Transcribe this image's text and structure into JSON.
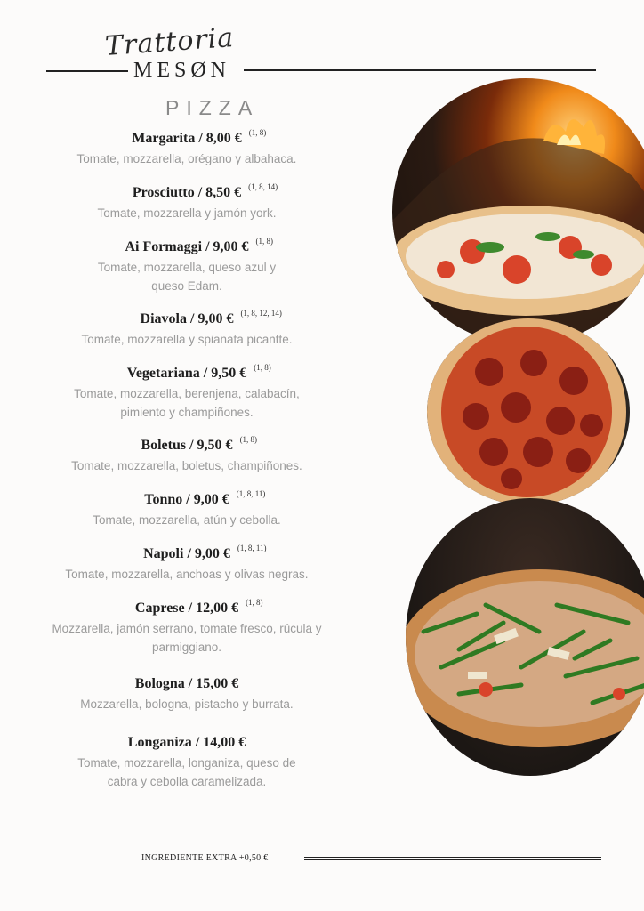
{
  "header": {
    "brand_script": "Trattoria",
    "brand_name": "MESØN",
    "section_title": "PIZZA"
  },
  "menu": {
    "items": [
      {
        "name": "Margarita / 8,00 €",
        "allergens": "(1, 8)",
        "description": "Tomate, mozzarella, orégano y albahaca."
      },
      {
        "name": "Prosciutto / 8,50 €",
        "allergens": "(1, 8, 14)",
        "description": "Tomate, mozzarella y jamón york."
      },
      {
        "name": "Ai Formaggi / 9,00 €",
        "allergens": "(1, 8)",
        "description": "Tomate, mozzarella, queso azul y queso Edam."
      },
      {
        "name": "Diavola / 9,00 €",
        "allergens": "(1, 8, 12, 14)",
        "description": "Tomate, mozzarella y spianata picantte."
      },
      {
        "name": "Vegetariana / 9,50 €",
        "allergens": "(1, 8)",
        "description": "Tomate, mozzarella, berenjena, calabacín, pimiento y champiñones."
      },
      {
        "name": "Boletus / 9,50 €",
        "allergens": "(1, 8)",
        "description": "Tomate, mozzarella, boletus, champiñones."
      },
      {
        "name": "Tonno / 9,00 €",
        "allergens": "(1, 8, 11)",
        "description": "Tomate, mozzarella, atún y cebolla."
      },
      {
        "name": "Napoli / 9,00 €",
        "allergens": "(1, 8, 11)",
        "description": "Tomate, mozzarella, anchoas y olivas negras."
      },
      {
        "name": "Caprese / 12,00 €",
        "allergens": "(1, 8)",
        "description": "Mozzarella, jamón serrano, tomate fresco, rúcula y parmiggiano."
      },
      {
        "name": "Bologna / 15,00 €",
        "allergens": "",
        "description": "Mozzarella, bologna, pistacho y burrata."
      },
      {
        "name": "Longaniza / 14,00 €",
        "allergens": "",
        "description": "Tomate, mozzarella, longaniza, queso de cabra y cebolla caramelizada."
      }
    ]
  },
  "photos": [
    {
      "icon": "pizza-margarita-oven-photo"
    },
    {
      "icon": "pizza-pepperoni-photo"
    },
    {
      "icon": "pizza-rucula-photo"
    }
  ],
  "footer": {
    "extra_note": "INGREDIENTE EXTRA +0,50 €"
  },
  "colors": {
    "background": "#fcfbfa",
    "text_dark": "#1e1e1e",
    "text_muted": "#9a9a9a"
  }
}
